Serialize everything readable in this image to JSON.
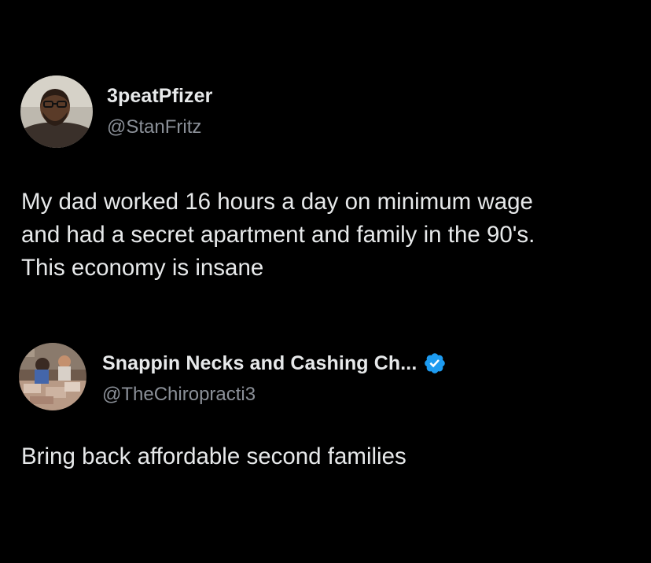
{
  "posts": [
    {
      "display_name": "3peatPfizer",
      "handle": "@StanFritz",
      "verified": false,
      "avatar_icon": "profile-photo",
      "text_lines": [
        "My dad worked 16 hours a day on minimum wage",
        "and had a secret apartment and family in the 90's.",
        "This economy is insane"
      ]
    },
    {
      "display_name": "Snappin Necks and Cashing Ch...",
      "handle": "@TheChiropracti3",
      "verified": true,
      "verified_icon": "verified-badge-icon",
      "verified_color": "#1d9bf0",
      "avatar_icon": "profile-photo",
      "text_lines": [
        "Bring back affordable second families"
      ]
    }
  ],
  "colors": {
    "background": "#000000",
    "primary_text": "#e7e9ea",
    "secondary_text": "#8b9098"
  }
}
